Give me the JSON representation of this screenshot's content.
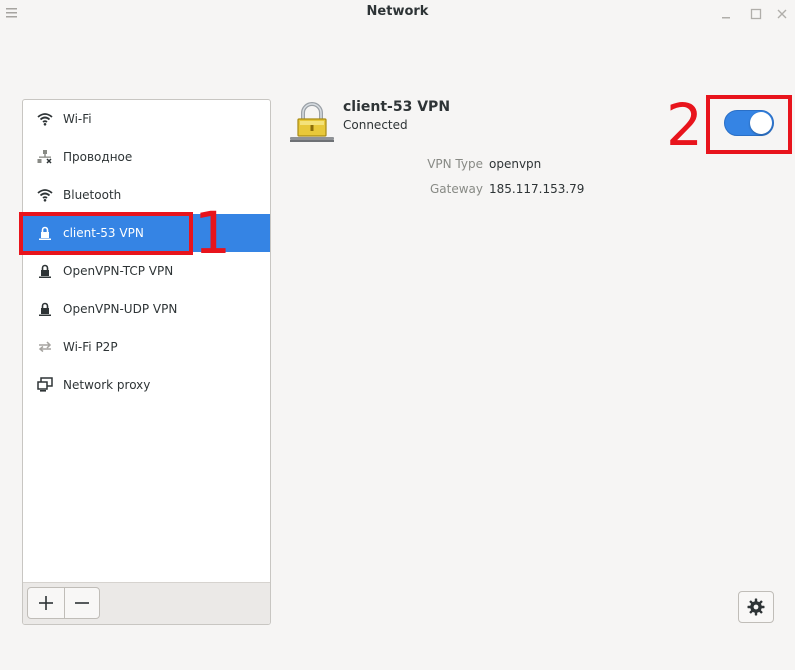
{
  "window": {
    "title": "Network"
  },
  "sidebar": {
    "items": [
      {
        "label": "Wi-Fi",
        "icon": "wifi-icon"
      },
      {
        "label": "Проводное",
        "icon": "wired-network-icon"
      },
      {
        "label": "Bluetooth",
        "icon": "bluetooth-icon"
      },
      {
        "label": "client-53 VPN",
        "icon": "vpn-lock-icon",
        "selected": true
      },
      {
        "label": "OpenVPN-TCP VPN",
        "icon": "vpn-lock-icon"
      },
      {
        "label": "OpenVPN-UDP VPN",
        "icon": "vpn-lock-icon"
      },
      {
        "label": "Wi-Fi P2P",
        "icon": "p2p-arrows-icon"
      },
      {
        "label": "Network proxy",
        "icon": "network-proxy-icon"
      }
    ],
    "add_label": "+",
    "remove_label": "−"
  },
  "detail": {
    "name": "client-53 VPN",
    "status": "Connected",
    "vpn_type_key": "VPN Type",
    "vpn_type_value": "openvpn",
    "gateway_key": "Gateway",
    "gateway_value": "185.117.153.79",
    "switch_on": true
  },
  "annotations": {
    "one": "1",
    "two": "2"
  },
  "colors": {
    "accent": "#3584e4",
    "annotation": "#e8141c"
  }
}
